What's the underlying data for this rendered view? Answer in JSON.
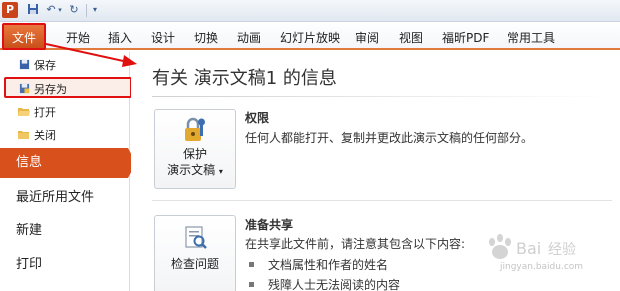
{
  "quick_access": {
    "app_icon": "P",
    "icons": [
      "save-icon",
      "undo-icon",
      "redo-icon",
      "customize-icon"
    ]
  },
  "ribbon": {
    "file_tab": "文件",
    "tabs": [
      "开始",
      "插入",
      "设计",
      "切换",
      "动画",
      "幻灯片放映",
      "审阅",
      "视图",
      "福昕PDF",
      "常用工具"
    ]
  },
  "backstage_menu": {
    "small_items": [
      {
        "label": "保存",
        "icon": "save-icon"
      },
      {
        "label": "另存为",
        "icon": "save-as-icon"
      },
      {
        "label": "打开",
        "icon": "open-folder-icon"
      },
      {
        "label": "关闭",
        "icon": "close-folder-icon"
      }
    ],
    "big_items": [
      "信息",
      "最近所用文件",
      "新建",
      "打印"
    ],
    "active_item": "信息"
  },
  "info_page": {
    "title": "有关 演示文稿1 的信息",
    "permissions": {
      "button_line1": "保护",
      "button_line2": "演示文稿",
      "heading": "权限",
      "description": "任何人都能打开、复制并更改此演示文稿的任何部分。"
    },
    "sharing": {
      "button_label": "检查问题",
      "heading": "准备共享",
      "description": "在共享此文件前，请注意其包含以下内容:",
      "bullets": [
        "文档属性和作者的姓名",
        "残障人士无法阅读的内容"
      ]
    }
  },
  "watermark": {
    "text": "jingyan.baidu.com"
  },
  "colors": {
    "accent": "#d8511d",
    "highlight_border": "#e01010"
  }
}
